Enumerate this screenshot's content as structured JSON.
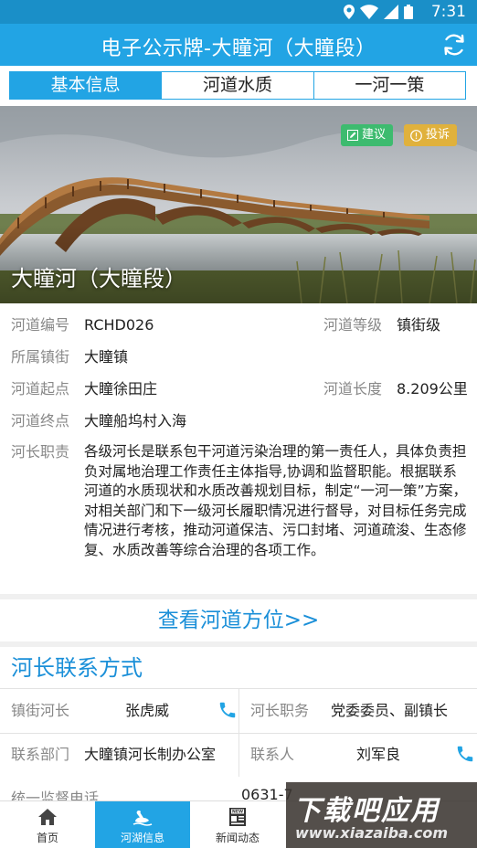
{
  "status_bar": {
    "time": "7:31"
  },
  "header": {
    "title": "电子公示牌-大瞳河（大瞳段）"
  },
  "tabs": [
    {
      "label": "基本信息",
      "active": true
    },
    {
      "label": "河道水质",
      "active": false
    },
    {
      "label": "一河一策",
      "active": false
    }
  ],
  "hero": {
    "river_name": "大瞳河（大瞳段）",
    "suggest_label": "建议",
    "complain_label": "投诉"
  },
  "info": {
    "code_label": "河道编号",
    "code_value": "RCHD026",
    "level_label": "河道等级",
    "level_value": "镇街级",
    "town_label": "所属镇街",
    "town_value": "大瞳镇",
    "start_label": "河道起点",
    "start_value": "大瞳徐田庄",
    "length_label": "河道长度",
    "length_value": "8.209公里",
    "end_label": "河道终点",
    "end_value": "大瞳船坞村入海",
    "duty_label": "河长职责",
    "duty_value": "各级河长是联系包干河道污染治理的第一责任人，具体负责担负对属地治理工作责任主体指导,协调和监督职能。根据联系河道的水质现状和水质改善规划目标，制定“一河一策”方案，对相关部门和下一级河长履职情况进行督导，对目标任务完成情况进行考核，推动河道保洁、污口封堵、河道疏浚、生态修复、水质改善等综合治理的各项工作。"
  },
  "view_location": "查看河道方位>>",
  "contact": {
    "title": "河长联系方式",
    "town_chief_label": "镇街河长",
    "town_chief_value": "张虎威",
    "position_label": "河长职务",
    "position_value": "党委委员、副镇长",
    "dept_label": "联系部门",
    "dept_value": "大瞳镇河长制办公室",
    "contact_person_label": "联系人",
    "contact_person_value": "刘军良",
    "hotline_label": "统一监督电话",
    "hotline_value": "0631-7"
  },
  "bottom_nav": [
    {
      "label": "首页",
      "active": false
    },
    {
      "label": "河湖信息",
      "active": true
    },
    {
      "label": "新闻动态",
      "active": false
    }
  ],
  "watermark": {
    "main": "下载吧应用",
    "url": "www.xiazaiba.com"
  },
  "colors": {
    "primary": "#22a4e4",
    "status_bar": "#1a8fc8",
    "link": "#1a8fd8",
    "suggest": "#3dbb6f",
    "complain": "#e0b13c"
  }
}
